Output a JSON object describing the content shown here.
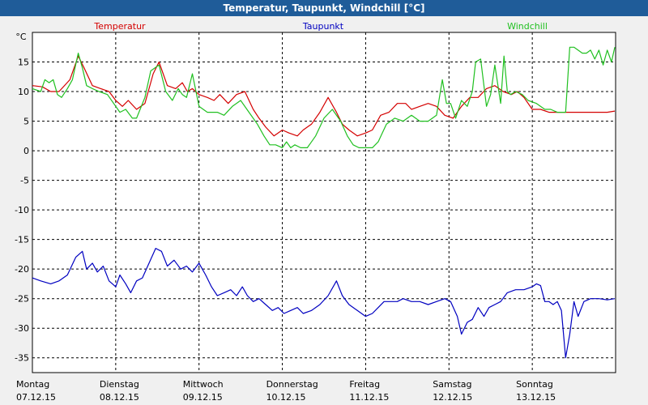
{
  "window": {
    "title": "Temperatur, Taupunkt, Windchill [°C]"
  },
  "chart_data": {
    "type": "line",
    "y_unit": "°C",
    "ylim": [
      -37.5,
      20
    ],
    "y_ticks": [
      15,
      10,
      5,
      0,
      -5,
      -10,
      -15,
      -20,
      -25,
      -30,
      -35
    ],
    "x_range": [
      0,
      7
    ],
    "x_ticks": [
      {
        "day": "Montag",
        "date": "07.12.15"
      },
      {
        "day": "Dienstag",
        "date": "08.12.15"
      },
      {
        "day": "Mittwoch",
        "date": "09.12.15"
      },
      {
        "day": "Donnerstag",
        "date": "10.12.15"
      },
      {
        "day": "Freitag",
        "date": "11.12.15"
      },
      {
        "day": "Samstag",
        "date": "12.12.15"
      },
      {
        "day": "Sonntag",
        "date": "13.12.15"
      }
    ],
    "grid": true,
    "legend": "top",
    "series": [
      {
        "name": "Temperatur",
        "color": "#d40000",
        "x": [
          0.0,
          0.12,
          0.22,
          0.32,
          0.45,
          0.55,
          0.62,
          0.72,
          0.82,
          0.92,
          1.0,
          1.08,
          1.15,
          1.25,
          1.35,
          1.45,
          1.52,
          1.62,
          1.72,
          1.8,
          1.86,
          1.92,
          2.0,
          2.1,
          2.18,
          2.25,
          2.35,
          2.45,
          2.55,
          2.65,
          2.72,
          2.8,
          2.9,
          3.0,
          3.08,
          3.18,
          3.25,
          3.35,
          3.45,
          3.55,
          3.65,
          3.72,
          3.8,
          3.9,
          4.0,
          4.08,
          4.18,
          4.28,
          4.38,
          4.48,
          4.55,
          4.65,
          4.75,
          4.85,
          4.95,
          5.05,
          5.15,
          5.25,
          5.35,
          5.45,
          5.55,
          5.65,
          5.75,
          5.82,
          5.9,
          6.0,
          6.1,
          6.2,
          6.3,
          6.4,
          6.5,
          6.6,
          6.7,
          6.8,
          6.9,
          6.99
        ],
        "values": [
          11.0,
          10.8,
          10.0,
          10.0,
          12.0,
          16.0,
          14.0,
          11.0,
          10.5,
          10.0,
          8.5,
          7.5,
          8.5,
          7.0,
          8.0,
          13.0,
          15.0,
          11.0,
          10.5,
          11.5,
          10.0,
          10.5,
          9.5,
          9.0,
          8.5,
          9.5,
          8.0,
          9.5,
          10.0,
          7.0,
          5.5,
          4.0,
          2.5,
          3.5,
          3.0,
          2.5,
          3.5,
          4.5,
          6.5,
          9.0,
          6.5,
          4.5,
          3.5,
          2.5,
          3.0,
          3.5,
          6.0,
          6.5,
          8.0,
          8.0,
          7.0,
          7.5,
          8.0,
          7.5,
          6.0,
          5.5,
          7.5,
          9.0,
          9.0,
          10.5,
          11.0,
          10.0,
          9.5,
          10.0,
          9.0,
          7.0,
          7.0,
          6.5,
          6.5,
          6.5,
          6.5,
          6.5,
          6.5,
          6.5,
          6.5,
          6.7
        ]
      },
      {
        "name": "Taupunkt",
        "color": "#0000c0",
        "x": [
          0.0,
          0.1,
          0.22,
          0.32,
          0.42,
          0.52,
          0.6,
          0.65,
          0.72,
          0.78,
          0.85,
          0.92,
          1.0,
          1.05,
          1.12,
          1.18,
          1.25,
          1.32,
          1.4,
          1.48,
          1.55,
          1.62,
          1.7,
          1.78,
          1.85,
          1.92,
          2.0,
          2.08,
          2.15,
          2.22,
          2.3,
          2.38,
          2.45,
          2.52,
          2.58,
          2.65,
          2.72,
          2.8,
          2.88,
          2.95,
          3.02,
          3.1,
          3.18,
          3.25,
          3.35,
          3.45,
          3.55,
          3.65,
          3.72,
          3.8,
          3.9,
          4.0,
          4.08,
          4.15,
          4.22,
          4.3,
          4.38,
          4.45,
          4.55,
          4.65,
          4.75,
          4.85,
          4.95,
          5.02,
          5.1,
          5.15,
          5.22,
          5.28,
          5.35,
          5.42,
          5.48,
          5.55,
          5.62,
          5.7,
          5.8,
          5.9,
          6.0,
          6.05,
          6.1,
          6.15,
          6.2,
          6.25,
          6.3,
          6.35,
          6.4,
          6.45,
          6.5,
          6.55,
          6.62,
          6.7,
          6.8,
          6.9,
          6.99
        ],
        "values": [
          -21.5,
          -22.0,
          -22.5,
          -22.0,
          -21.0,
          -18.0,
          -17.0,
          -20.0,
          -19.0,
          -20.5,
          -19.5,
          -22.0,
          -23.0,
          -21.0,
          -22.5,
          -24.0,
          -22.0,
          -21.5,
          -19.0,
          -16.5,
          -17.0,
          -19.5,
          -18.5,
          -20.0,
          -19.5,
          -20.5,
          -19.0,
          -21.0,
          -23.0,
          -24.5,
          -24.0,
          -23.5,
          -24.5,
          -23.0,
          -24.5,
          -25.5,
          -25.0,
          -26.0,
          -27.0,
          -26.5,
          -27.5,
          -27.0,
          -26.5,
          -27.5,
          -27.0,
          -26.0,
          -24.5,
          -22.0,
          -24.5,
          -26.0,
          -27.0,
          -28.0,
          -27.5,
          -26.5,
          -25.5,
          -25.5,
          -25.5,
          -25.0,
          -25.5,
          -25.5,
          -26.0,
          -25.5,
          -25.0,
          -25.5,
          -28.0,
          -31.0,
          -29.0,
          -28.5,
          -26.5,
          -28.0,
          -26.5,
          -26.0,
          -25.5,
          -24.0,
          -23.5,
          -23.5,
          -23.0,
          -22.5,
          -22.8,
          -25.5,
          -25.5,
          -26.0,
          -25.5,
          -27.0,
          -35.0,
          -31.0,
          -25.5,
          -28.0,
          -25.5,
          -25.0,
          -25.0,
          -25.2,
          -25.0
        ]
      },
      {
        "name": "Windchill",
        "color": "#20c020",
        "x": [
          0.0,
          0.1,
          0.15,
          0.2,
          0.25,
          0.3,
          0.35,
          0.42,
          0.48,
          0.55,
          0.6,
          0.65,
          0.72,
          0.8,
          0.9,
          1.0,
          1.05,
          1.12,
          1.2,
          1.25,
          1.35,
          1.42,
          1.52,
          1.6,
          1.68,
          1.75,
          1.8,
          1.85,
          1.92,
          2.0,
          2.05,
          2.1,
          2.15,
          2.22,
          2.3,
          2.4,
          2.5,
          2.6,
          2.7,
          2.78,
          2.85,
          2.92,
          3.0,
          3.05,
          3.1,
          3.15,
          3.22,
          3.3,
          3.4,
          3.5,
          3.6,
          3.7,
          3.78,
          3.85,
          3.92,
          4.0,
          4.08,
          4.15,
          4.25,
          4.35,
          4.45,
          4.55,
          4.65,
          4.75,
          4.85,
          4.92,
          4.97,
          5.02,
          5.08,
          5.15,
          5.22,
          5.28,
          5.32,
          5.38,
          5.45,
          5.5,
          5.55,
          5.62,
          5.66,
          5.7,
          5.74,
          5.8,
          5.88,
          5.95,
          6.05,
          6.15,
          6.22,
          6.3,
          6.4,
          6.45,
          6.5,
          6.55,
          6.6,
          6.65,
          6.7,
          6.75,
          6.8,
          6.85,
          6.9,
          6.95,
          6.99
        ],
        "values": [
          10.5,
          10.0,
          12.0,
          11.5,
          12.0,
          9.5,
          9.0,
          10.5,
          12.0,
          16.5,
          14.0,
          11.0,
          10.5,
          10.0,
          9.5,
          7.5,
          6.5,
          7.0,
          5.5,
          5.5,
          9.0,
          13.5,
          14.5,
          10.0,
          8.5,
          10.5,
          9.5,
          9.0,
          13.0,
          7.5,
          7.0,
          6.5,
          6.5,
          6.5,
          6.0,
          7.5,
          8.5,
          6.5,
          4.5,
          2.5,
          1.0,
          1.0,
          0.5,
          1.5,
          0.5,
          1.0,
          0.5,
          0.5,
          2.5,
          5.5,
          7.0,
          5.0,
          2.5,
          1.0,
          0.5,
          0.5,
          0.5,
          1.5,
          4.5,
          5.5,
          5.0,
          6.0,
          5.0,
          5.0,
          6.0,
          12.0,
          8.0,
          8.0,
          5.5,
          8.5,
          7.5,
          10.0,
          15.0,
          15.5,
          7.5,
          9.5,
          14.5,
          8.0,
          16.0,
          10.0,
          9.5,
          10.0,
          9.5,
          8.5,
          8.0,
          7.0,
          7.0,
          6.5,
          6.5,
          17.5,
          17.5,
          17.0,
          16.5,
          16.5,
          17.0,
          15.5,
          17.0,
          14.5,
          17.0,
          15.0,
          17.5
        ]
      }
    ]
  }
}
